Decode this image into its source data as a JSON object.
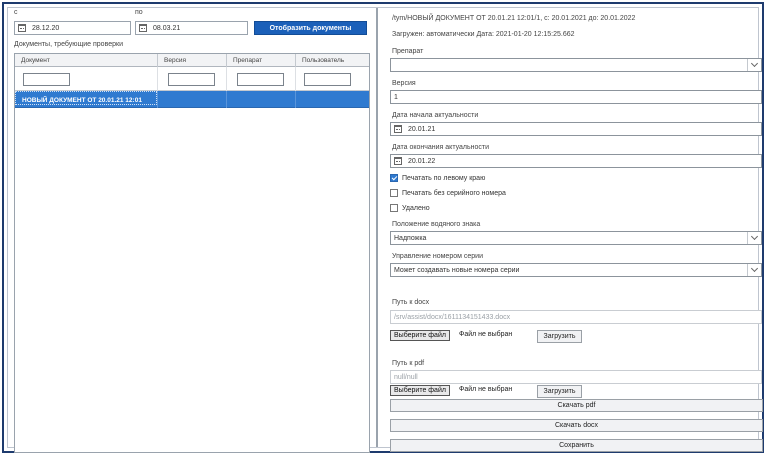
{
  "filter": {
    "from_label": "с",
    "from_value": "28.12.20",
    "to_label": "по",
    "to_value": "08.03.21",
    "show_button": "Отобразить документы"
  },
  "grid": {
    "title": "Документы, требующие проверки",
    "columns": [
      "Документ",
      "Версия",
      "Препарат",
      "Пользователь"
    ],
    "rows": [
      {
        "document": "НОВЫЙ ДОКУМЕНТ ОТ 20.01.21 12:01",
        "version": "",
        "drug": "",
        "user": ""
      }
    ]
  },
  "detail": {
    "path_title": "/tym/НОВЫЙ ДОКУМЕНТ ОТ 20.01.21 12:01/1, с: 20.01.2021 до: 20.01.2022",
    "loaded": "Загружен: автоматически Дата: 2021-01-20 12:15:25.662",
    "drug_label": "Препарат",
    "drug_value": "",
    "version_label": "Версия",
    "version_value": "1",
    "start_label": "Дата начала актуальности",
    "start_value": "20.01.21",
    "end_label": "Дата окончания актуальности",
    "end_value": "20.01.22",
    "cb_left_label": "Печатать по левому краю",
    "cb_left_checked": true,
    "cb_serial_label": "Печатать без серийного номера",
    "cb_serial_checked": false,
    "cb_deleted_label": "Удалено",
    "cb_deleted_checked": false,
    "watermark_label": "Положение водяного знака",
    "watermark_value": "Надпожка",
    "serial_label": "Управление номером серии",
    "serial_value": "Может создавать новые номера серии",
    "docx_label": "Путь к docx",
    "docx_value": "/srv/assist/docx/1611134151433.docx",
    "pdf_label": "Путь к pdf",
    "pdf_value": "null/null",
    "choose_file": "Выберите файл",
    "no_file": "Файл не выбран",
    "upload": "Загрузить",
    "download_pdf": "Скачать pdf",
    "download_docx": "Скачать docx",
    "save": "Сохранить"
  }
}
